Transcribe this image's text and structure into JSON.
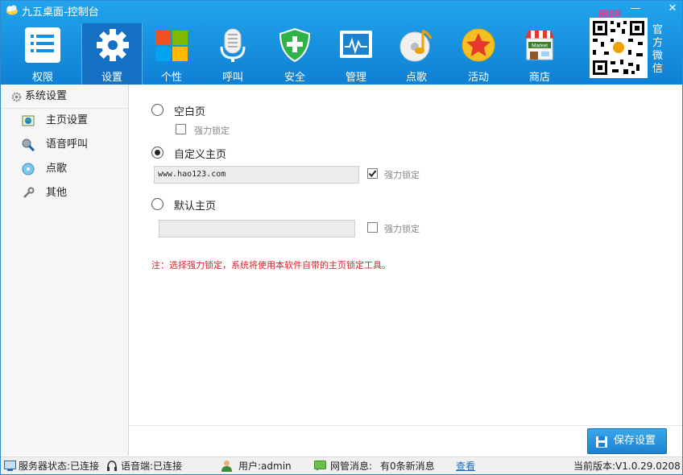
{
  "window": {
    "title": "九五桌面-控制台",
    "minimize": "—",
    "close": "✕"
  },
  "nav": [
    {
      "label": "权限",
      "icon": "permissions-icon"
    },
    {
      "label": "设置",
      "icon": "gear-icon"
    },
    {
      "label": "个性",
      "icon": "windows-tiles-icon"
    },
    {
      "label": "呼叫",
      "icon": "microphone-icon"
    },
    {
      "label": "安全",
      "icon": "shield-plus-icon"
    },
    {
      "label": "管理",
      "icon": "monitor-icon"
    },
    {
      "label": "点歌",
      "icon": "music-cd-icon"
    },
    {
      "label": "活动",
      "icon": "star-badge-icon"
    },
    {
      "label": "商店",
      "icon": "market-store-icon"
    }
  ],
  "market_sign": "Market",
  "qr": {
    "badge": "网吧",
    "side_label": "官方微信"
  },
  "sidebar": {
    "header": "系统设置",
    "items": [
      {
        "label": "主页设置",
        "icon": "homepage-icon"
      },
      {
        "label": "语音呼叫",
        "icon": "microphone-small-icon"
      },
      {
        "label": "点歌",
        "icon": "music-small-icon"
      },
      {
        "label": "其他",
        "icon": "wrench-icon"
      }
    ]
  },
  "main": {
    "blank_page": {
      "label": "空白页",
      "lock_label": "强力锁定",
      "lock_checked": false
    },
    "custom_home": {
      "label": "自定义主页",
      "url": "www.hao123.com",
      "lock_label": "强力锁定",
      "lock_checked": true
    },
    "default_home": {
      "label": "默认主页",
      "url": "",
      "lock_label": "强力锁定",
      "lock_checked": false
    },
    "note": "注：选择强力锁定，系统将使用本软件自带的主页锁定工具。",
    "save_label": "保存设置"
  },
  "status": {
    "server": "服务器状态:已连接",
    "voice": "语音端:已连接",
    "user": "用户:admin",
    "msg_label": "网管消息:",
    "msg_value": "有0条新消息",
    "view_link": "查看",
    "version": "当前版本:V1.0.29.0208"
  },
  "colors": {
    "header": "#1591dd",
    "accent": "#1a82d0",
    "note": "#e0202a"
  }
}
